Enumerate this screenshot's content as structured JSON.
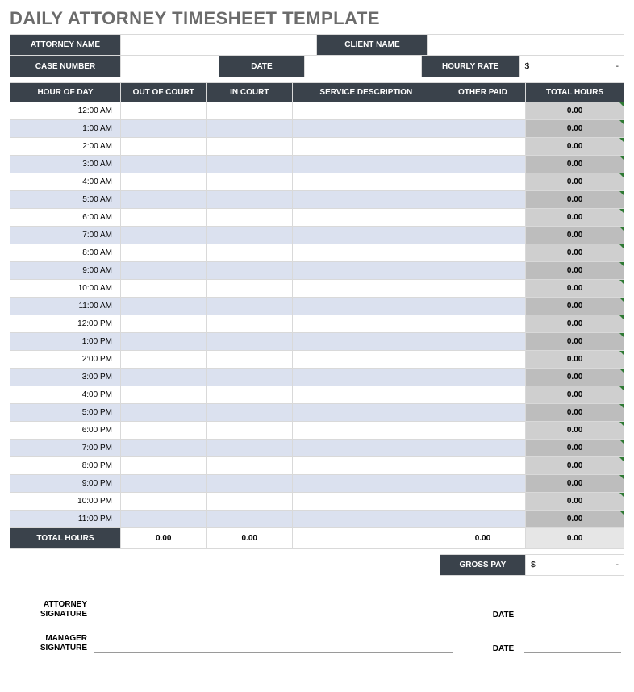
{
  "title": "DAILY ATTORNEY TIMESHEET TEMPLATE",
  "info": {
    "attorney_name_lbl": "ATTORNEY NAME",
    "attorney_name_val": "",
    "client_name_lbl": "CLIENT NAME",
    "client_name_val": "",
    "case_number_lbl": "CASE NUMBER",
    "case_number_val": "",
    "date_lbl": "DATE",
    "date_val": "",
    "hourly_rate_lbl": "HOURLY RATE",
    "hourly_rate_currency": "$",
    "hourly_rate_val": "-"
  },
  "columns": {
    "hour_of_day": "HOUR OF DAY",
    "out_of_court": "OUT OF COURT",
    "in_court": "IN COURT",
    "service_description": "SERVICE DESCRIPTION",
    "other_paid": "OTHER PAID",
    "total_hours": "TOTAL HOURS"
  },
  "rows": [
    {
      "hour": "12:00 AM",
      "out": "",
      "in": "",
      "desc": "",
      "other": "",
      "total": "0.00"
    },
    {
      "hour": "1:00 AM",
      "out": "",
      "in": "",
      "desc": "",
      "other": "",
      "total": "0.00"
    },
    {
      "hour": "2:00 AM",
      "out": "",
      "in": "",
      "desc": "",
      "other": "",
      "total": "0.00"
    },
    {
      "hour": "3:00 AM",
      "out": "",
      "in": "",
      "desc": "",
      "other": "",
      "total": "0.00"
    },
    {
      "hour": "4:00 AM",
      "out": "",
      "in": "",
      "desc": "",
      "other": "",
      "total": "0.00"
    },
    {
      "hour": "5:00 AM",
      "out": "",
      "in": "",
      "desc": "",
      "other": "",
      "total": "0.00"
    },
    {
      "hour": "6:00 AM",
      "out": "",
      "in": "",
      "desc": "",
      "other": "",
      "total": "0.00"
    },
    {
      "hour": "7:00 AM",
      "out": "",
      "in": "",
      "desc": "",
      "other": "",
      "total": "0.00"
    },
    {
      "hour": "8:00 AM",
      "out": "",
      "in": "",
      "desc": "",
      "other": "",
      "total": "0.00"
    },
    {
      "hour": "9:00 AM",
      "out": "",
      "in": "",
      "desc": "",
      "other": "",
      "total": "0.00"
    },
    {
      "hour": "10:00 AM",
      "out": "",
      "in": "",
      "desc": "",
      "other": "",
      "total": "0.00"
    },
    {
      "hour": "11:00 AM",
      "out": "",
      "in": "",
      "desc": "",
      "other": "",
      "total": "0.00"
    },
    {
      "hour": "12:00 PM",
      "out": "",
      "in": "",
      "desc": "",
      "other": "",
      "total": "0.00"
    },
    {
      "hour": "1:00 PM",
      "out": "",
      "in": "",
      "desc": "",
      "other": "",
      "total": "0.00"
    },
    {
      "hour": "2:00 PM",
      "out": "",
      "in": "",
      "desc": "",
      "other": "",
      "total": "0.00"
    },
    {
      "hour": "3:00 PM",
      "out": "",
      "in": "",
      "desc": "",
      "other": "",
      "total": "0.00"
    },
    {
      "hour": "4:00 PM",
      "out": "",
      "in": "",
      "desc": "",
      "other": "",
      "total": "0.00"
    },
    {
      "hour": "5:00 PM",
      "out": "",
      "in": "",
      "desc": "",
      "other": "",
      "total": "0.00"
    },
    {
      "hour": "6:00 PM",
      "out": "",
      "in": "",
      "desc": "",
      "other": "",
      "total": "0.00"
    },
    {
      "hour": "7:00 PM",
      "out": "",
      "in": "",
      "desc": "",
      "other": "",
      "total": "0.00"
    },
    {
      "hour": "8:00 PM",
      "out": "",
      "in": "",
      "desc": "",
      "other": "",
      "total": "0.00"
    },
    {
      "hour": "9:00 PM",
      "out": "",
      "in": "",
      "desc": "",
      "other": "",
      "total": "0.00"
    },
    {
      "hour": "10:00 PM",
      "out": "",
      "in": "",
      "desc": "",
      "other": "",
      "total": "0.00"
    },
    {
      "hour": "11:00 PM",
      "out": "",
      "in": "",
      "desc": "",
      "other": "",
      "total": "0.00"
    }
  ],
  "totals": {
    "label": "TOTAL HOURS",
    "out": "0.00",
    "in": "0.00",
    "desc": "",
    "other": "0.00",
    "total": "0.00"
  },
  "gross_pay": {
    "label": "GROSS PAY",
    "currency": "$",
    "value": "-"
  },
  "signatures": {
    "attorney_lbl": "ATTORNEY SIGNATURE",
    "manager_lbl": "MANAGER SIGNATURE",
    "date_lbl": "DATE"
  }
}
